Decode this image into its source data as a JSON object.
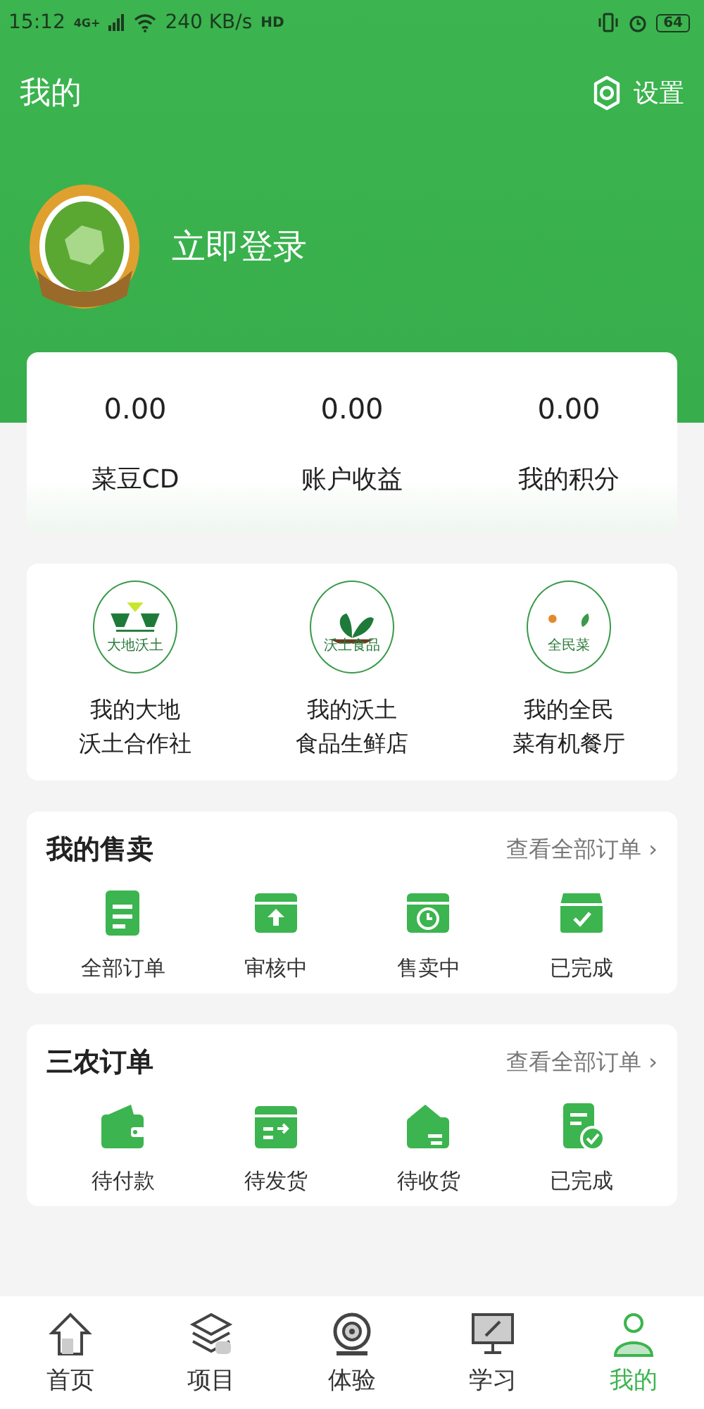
{
  "status_bar": {
    "time": "15:12",
    "network": "4G+",
    "speed": "240 KB/s",
    "hd": "HD",
    "battery": "64"
  },
  "header": {
    "title": "我的",
    "settings": "设置"
  },
  "profile": {
    "login": "立即登录"
  },
  "stats": [
    {
      "value": "0.00",
      "label": "菜豆CD"
    },
    {
      "value": "0.00",
      "label": "账户收益"
    },
    {
      "value": "0.00",
      "label": "我的积分"
    }
  ],
  "shops": [
    {
      "kind": "dadi",
      "logo_text": "大地沃土",
      "line1": "我的大地",
      "line2": "沃土合作社"
    },
    {
      "kind": "wotu",
      "logo_text": "沃土食品",
      "line1": "我的沃土",
      "line2": "食品生鲜店"
    },
    {
      "kind": "quanmin",
      "logo_text": "全民菜",
      "line1": "我的全民",
      "line2": "菜有机餐厅"
    }
  ],
  "sections": [
    {
      "title": "我的售卖",
      "more": "查看全部订单 ›",
      "items": [
        {
          "kind": "doc",
          "label": "全部订单"
        },
        {
          "kind": "upbox",
          "label": "审核中"
        },
        {
          "kind": "clockbox",
          "label": "售卖中"
        },
        {
          "kind": "checkbox",
          "label": "已完成"
        }
      ]
    },
    {
      "title": "三农订单",
      "more": "查看全部订单 ›",
      "items": [
        {
          "kind": "wallet",
          "label": "待付款"
        },
        {
          "kind": "ship",
          "label": "待发货"
        },
        {
          "kind": "receive",
          "label": "待收货"
        },
        {
          "kind": "done",
          "label": "已完成"
        }
      ]
    }
  ],
  "tabs": [
    {
      "kind": "home",
      "label": "首页",
      "selected": false
    },
    {
      "kind": "layers",
      "label": "项目",
      "selected": false
    },
    {
      "kind": "camera",
      "label": "体验",
      "selected": false
    },
    {
      "kind": "monitor",
      "label": "学习",
      "selected": false
    },
    {
      "kind": "person",
      "label": "我的",
      "selected": true
    }
  ]
}
